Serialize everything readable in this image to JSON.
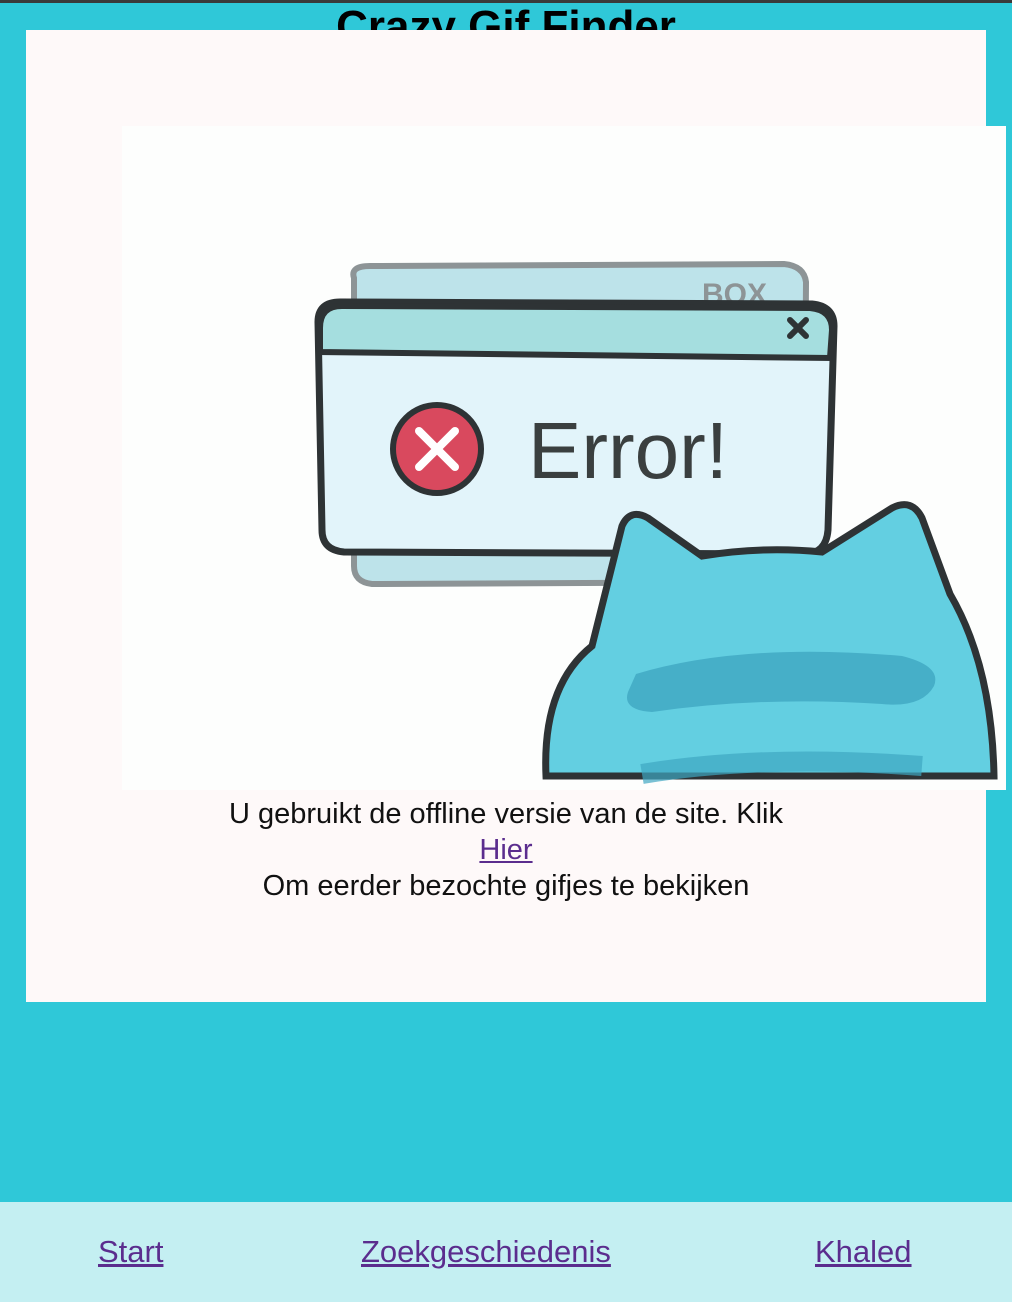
{
  "app": {
    "title": "Crazy Gif Finder"
  },
  "modal": {
    "gif": {
      "caption": "Error!"
    },
    "message_line1": "U gebruikt de offline versie van de site. Klik",
    "link_label": "Hier",
    "message_line2": "Om eerder bezochte gifjes te bekijken"
  },
  "footer": {
    "links": [
      {
        "label": "Start"
      },
      {
        "label": "Zoekgeschiedenis"
      },
      {
        "label": "Khaled"
      }
    ]
  },
  "colors": {
    "background": "#2fc8d8",
    "modal": "#fef9f9",
    "footer": "#c4eff2",
    "link": "#5b2d8e"
  }
}
